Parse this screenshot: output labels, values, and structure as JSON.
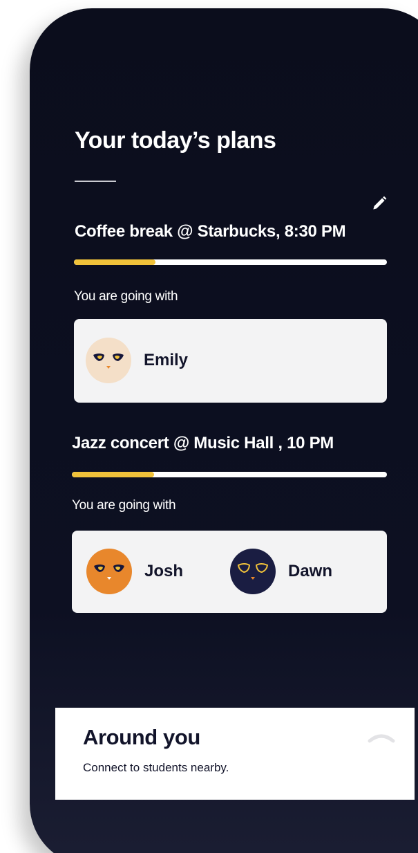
{
  "header": {
    "title": "Your today’s plans"
  },
  "plans": [
    {
      "title": "Coffee break @ Starbucks, 8:30 PM",
      "progress": 0.26,
      "going_label": "You are going with",
      "companions": [
        {
          "name": "Emily",
          "avatar_color": "#f4dfc8",
          "eye_style": "filled"
        }
      ]
    },
    {
      "title": "Jazz concert @ Music Hall , 10 PM",
      "progress": 0.26,
      "going_label": "You are going with",
      "companions": [
        {
          "name": "Josh",
          "avatar_color": "#e8872c",
          "eye_style": "filled"
        },
        {
          "name": "Dawn",
          "avatar_color": "#1a1d42",
          "eye_style": "outline"
        }
      ]
    }
  ],
  "around_you": {
    "title": "Around you",
    "subtitle": "Connect to students nearby."
  },
  "icons": {
    "edit": "pencil-icon",
    "expand": "chevron-up-icon"
  },
  "colors": {
    "background": "#0b0d1c",
    "accent": "#f1c23a",
    "card": "#f3f3f4",
    "text_dark": "#12142a"
  }
}
